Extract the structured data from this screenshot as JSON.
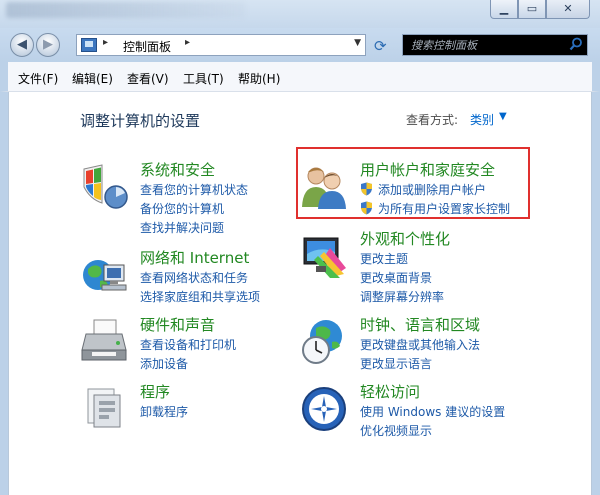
{
  "address": {
    "path": "控制面板"
  },
  "search": {
    "placeholder": "搜索控制面板"
  },
  "menu": [
    "文件(F)",
    "编辑(E)",
    "查看(V)",
    "工具(T)",
    "帮助(H)"
  ],
  "page": {
    "title": "调整计算机的设置",
    "view_by_label": "查看方式:",
    "view_by_value": "类别"
  },
  "categories": [
    {
      "title": "系统和安全",
      "links": [
        "查看您的计算机状态",
        "备份您的计算机",
        "查找并解决问题"
      ]
    },
    {
      "title": "网络和 Internet",
      "links": [
        "查看网络状态和任务",
        "选择家庭组和共享选项"
      ]
    },
    {
      "title": "硬件和声音",
      "links": [
        "查看设备和打印机",
        "添加设备"
      ]
    },
    {
      "title": "程序",
      "links": [
        "卸载程序"
      ]
    },
    {
      "title": "用户帐户和家庭安全",
      "links": [
        "添加或删除用户帐户",
        "为所有用户设置家长控制"
      ]
    },
    {
      "title": "外观和个性化",
      "links": [
        "更改主题",
        "更改桌面背景",
        "调整屏幕分辨率"
      ]
    },
    {
      "title": "时钟、语言和区域",
      "links": [
        "更改键盘或其他输入法",
        "更改显示语言"
      ]
    },
    {
      "title": "轻松访问",
      "links": [
        "使用 Windows 建议的设置",
        "优化视频显示"
      ]
    }
  ],
  "colors": {
    "heading": "#228822",
    "link": "#1e5aa8",
    "highlight": "#e0302e"
  }
}
